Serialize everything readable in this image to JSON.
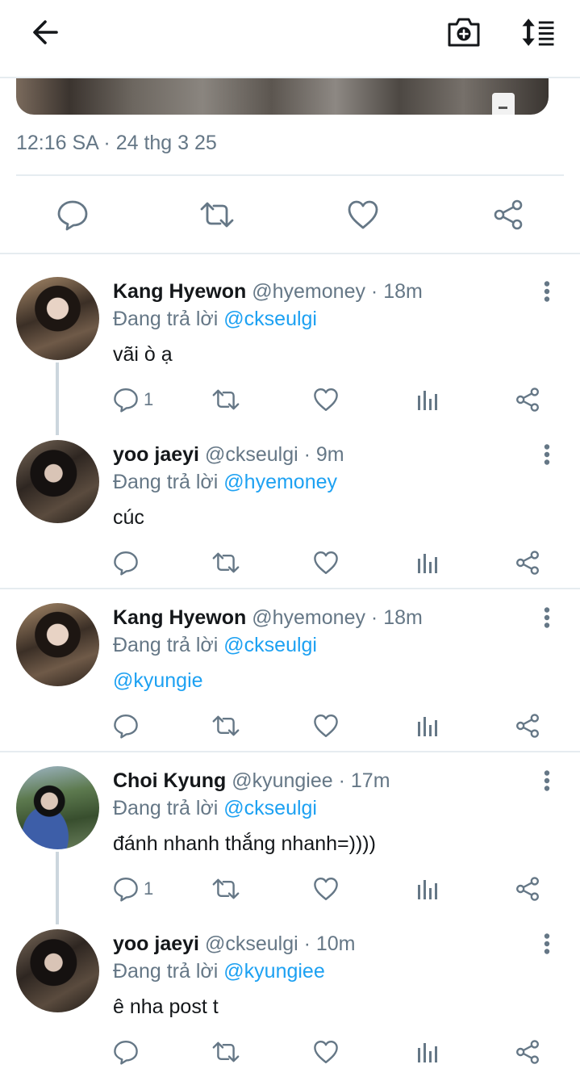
{
  "header": {
    "back_icon": "arrow-left-icon",
    "camera_icon": "camera-add-icon",
    "sort_icon": "sort-icon"
  },
  "tweet": {
    "timestamp": "12:16 SA · 24 thg 3 25",
    "actions": [
      "reply-icon",
      "retweet-icon",
      "like-icon",
      "share-icon"
    ]
  },
  "replies": [
    {
      "name": "Kang Hyewon",
      "handle": "@hyemoney · 18m",
      "replying_prefix": "Đang trả lời ",
      "replying_to": "@ckseulgi",
      "text": "vãi ò ạ",
      "reply_count": "1"
    },
    {
      "name": "yoo jaeyi",
      "handle": "@ckseulgi · 9m",
      "replying_prefix": "Đang trả lời ",
      "replying_to": "@hyemoney",
      "text": "cúc",
      "reply_count": ""
    },
    {
      "name": "Kang Hyewon",
      "handle": "@hyemoney · 18m",
      "replying_prefix": "Đang trả lời ",
      "replying_to": "@ckseulgi",
      "text": "@kyungie",
      "reply_count": ""
    },
    {
      "name": "Choi Kyung",
      "handle": "@kyungiee · 17m",
      "replying_prefix": "Đang trả lời ",
      "replying_to": "@ckseulgi",
      "text": "đánh nhanh thắng nhanh=))))",
      "reply_count": "1"
    },
    {
      "name": "yoo jaeyi",
      "handle": "@ckseulgi · 10m",
      "replying_prefix": "Đang trả lời ",
      "replying_to": "@kyungiee",
      "text": "ê nha post t",
      "reply_count": ""
    }
  ],
  "colors": {
    "accent": "#1da1f2",
    "secondary_text": "#657786",
    "primary_text": "#14171a",
    "divider": "#e6ecf0"
  }
}
